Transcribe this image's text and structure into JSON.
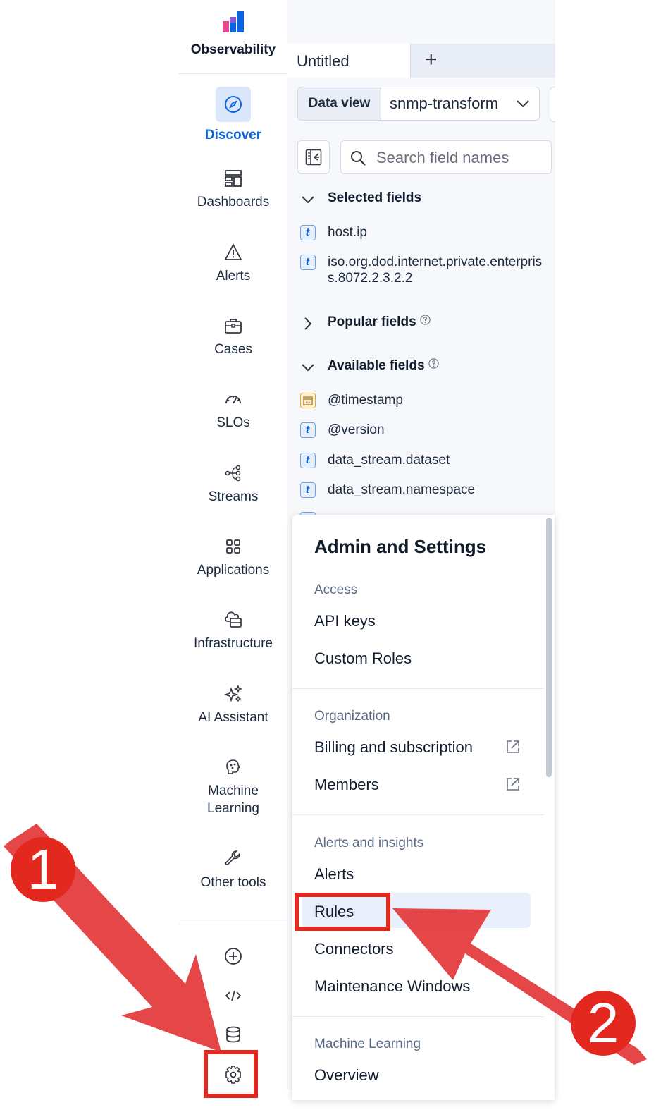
{
  "sidebar": {
    "brand": "Observability",
    "nav": [
      {
        "label": "Discover",
        "icon": "compass-icon",
        "active": true
      },
      {
        "label": "Dashboards",
        "icon": "dashboard-icon"
      },
      {
        "label": "Alerts",
        "icon": "warning-icon"
      },
      {
        "label": "Cases",
        "icon": "briefcase-icon"
      },
      {
        "label": "SLOs",
        "icon": "gauge-icon"
      },
      {
        "label": "Streams",
        "icon": "streams-icon"
      },
      {
        "label": "Applications",
        "icon": "grid-icon"
      },
      {
        "label": "Infrastructure",
        "icon": "infrastructure-icon"
      },
      {
        "label": "AI Assistant",
        "icon": "sparkles-icon"
      },
      {
        "label": "Machine Learning",
        "icon": "machine-learning-icon"
      },
      {
        "label": "Other tools",
        "icon": "wrench-icon"
      }
    ],
    "bottom_icons": [
      "plus-circle-icon",
      "code-icon",
      "database-icon",
      "gear-icon"
    ]
  },
  "main": {
    "tab_title": "Untitled",
    "tab_add": "+",
    "data_view_label": "Data view",
    "data_view_value": "snmp-transform",
    "search_placeholder": "Search field names",
    "selected_fields_title": "Selected fields",
    "selected_fields": [
      "host.ip",
      "iso.org.dod.internet.private.enterpris",
      "s.8072.2.3.2.2"
    ],
    "popular_fields_title": "Popular fields",
    "available_fields_title": "Available fields",
    "available_fields": [
      "@timestamp",
      "@version",
      "data_stream.dataset",
      "data_stream.namespace"
    ]
  },
  "popover": {
    "title": "Admin and Settings",
    "groups": [
      {
        "label": "Access",
        "items": [
          "API keys",
          "Custom Roles"
        ]
      },
      {
        "label": "Organization",
        "items": [
          "Billing and subscription",
          "Members"
        ]
      },
      {
        "label": "Alerts and insights",
        "items": [
          "Alerts",
          "Rules",
          "Connectors",
          "Maintenance Windows"
        ]
      },
      {
        "label": "Machine Learning",
        "items": [
          "Overview"
        ]
      }
    ]
  },
  "annotations": {
    "step1": "1",
    "step2": "2",
    "color": "#e3281f"
  },
  "colors": {
    "accent": "#0b64dd",
    "annotation_red": "#e02a20"
  }
}
